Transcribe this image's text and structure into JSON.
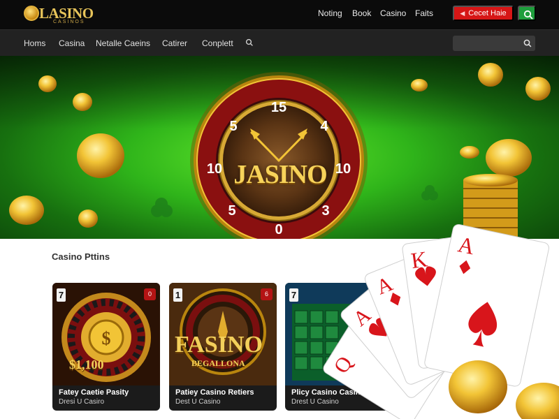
{
  "brand": {
    "name": "LASINO",
    "subtitle": "CASINOS"
  },
  "top_nav": [
    "Noting",
    "Book",
    "Casino",
    "Faits"
  ],
  "cta": {
    "label": "Cecet Haie",
    "icon": "arrow-icon",
    "color": "#d61616"
  },
  "search_button": {
    "icon": "search-icon",
    "color": "#1e9e3c"
  },
  "sub_nav": [
    "Homs",
    "Casina",
    "Netalle Caeins",
    "Catirer",
    "Conplett"
  ],
  "search": {
    "placeholder": "",
    "value": ""
  },
  "hero": {
    "wheel_brand": "JASINO",
    "wheel_numbers": [
      "15",
      "4",
      "10",
      "3",
      "0",
      "5",
      "10",
      "5"
    ]
  },
  "section": {
    "title": "Casino Pttins"
  },
  "cards": [
    {
      "number": "7",
      "badge": "0",
      "title": "Fatey Caetie Pasity",
      "subtitle": "Dresi U Casiro",
      "overlay": "$1,100"
    },
    {
      "number": "1",
      "badge": "6",
      "title": "Patiey Casino Retiers",
      "subtitle": "Dest U Casino",
      "overlay": "FASINO",
      "overlay_sub": "BEGALLONA"
    },
    {
      "number": "7",
      "badge": "",
      "title": "Plicy Casino Casinos",
      "subtitle": "Drest U Casino"
    }
  ],
  "playing_cards": [
    "Q",
    "A",
    "A",
    "K",
    "A"
  ],
  "colors": {
    "accent_red": "#d61616",
    "accent_green": "#1e9e3c",
    "gold": "#e7c45a",
    "topbar": "#0b0b0b"
  }
}
